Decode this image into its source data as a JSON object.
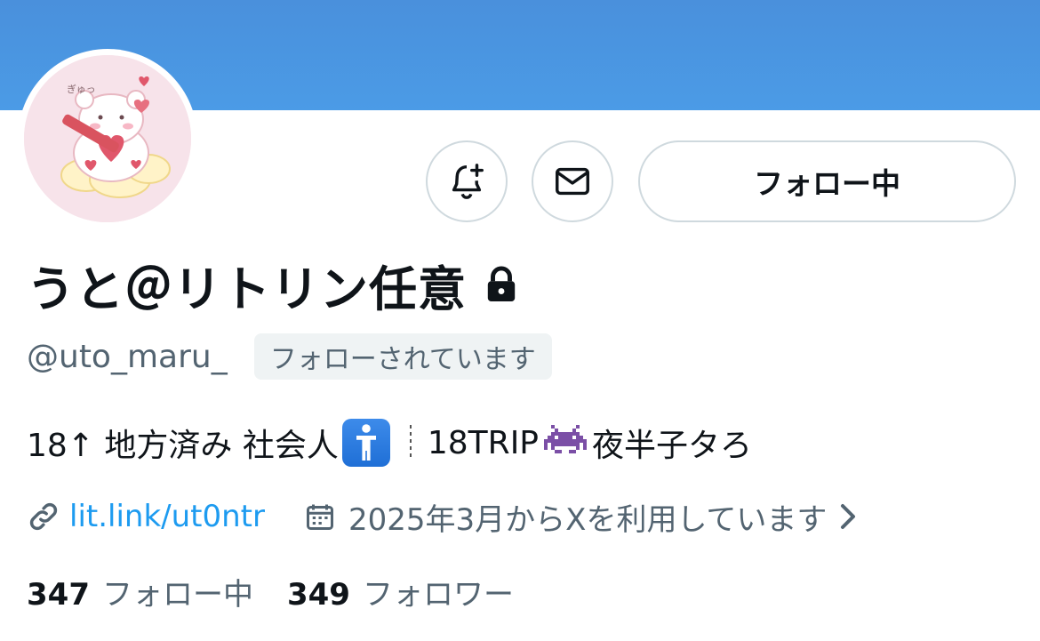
{
  "profile": {
    "display_name": "うと＠リトリン任意",
    "handle": "@uto_maru_",
    "follows_you_badge": "フォローされています",
    "bio": {
      "part1": "18↑ 地方済み 社会人",
      "part2": "18TRIP",
      "part3": "夜半子タろ"
    },
    "link": "lit.link/ut0ntr",
    "joined": "2025年3月からXを利用しています",
    "following_count": "347",
    "following_label": "フォロー中",
    "followers_count": "349",
    "followers_label": "フォロワー"
  },
  "actions": {
    "follow_button_label": "フォロー中"
  },
  "icons": {
    "bell": "bell-plus-icon",
    "mail": "envelope-icon",
    "lock": "lock-icon",
    "link": "link-icon",
    "calendar": "calendar-icon",
    "chevron": "chevron-right-icon",
    "bio_emoji_1": "person-standing-emoji",
    "bio_emoji_2": "space-invader-emoji"
  },
  "colors": {
    "banner": "#4a90dc",
    "link": "#1d9bf0",
    "secondary_text": "#536471",
    "primary_text": "#0f1419",
    "border": "#cfd9de",
    "avatar_bg": "#f7e3ea"
  }
}
